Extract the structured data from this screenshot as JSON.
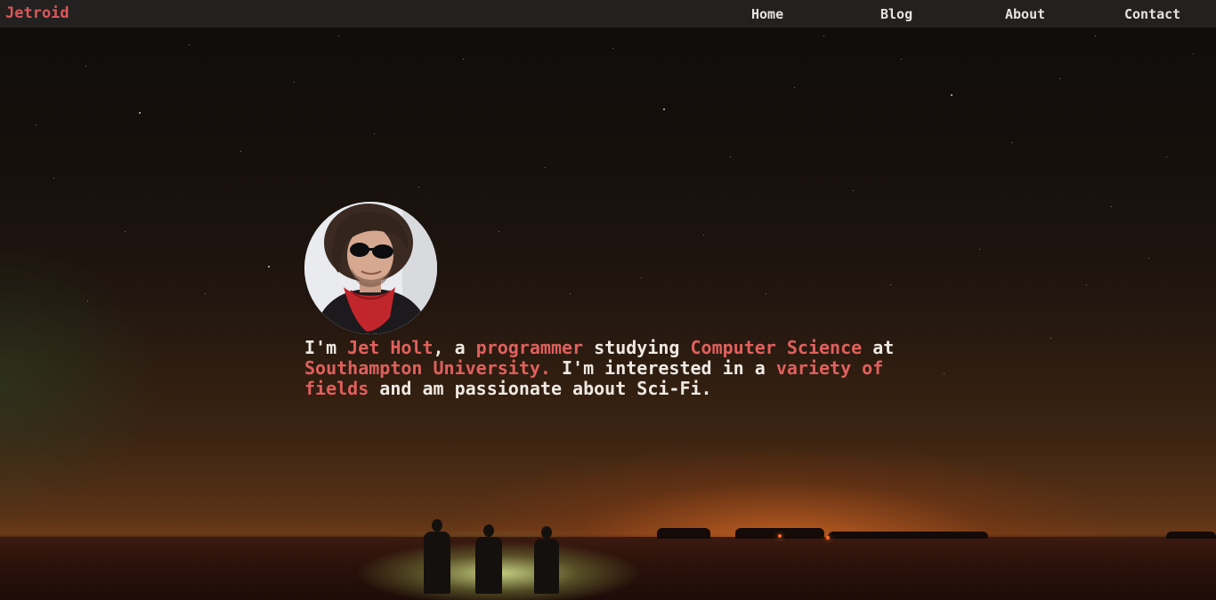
{
  "nav": {
    "brand": "Jetroid",
    "links": [
      "Home",
      "Blog",
      "About",
      "Contact"
    ]
  },
  "profile": {
    "avatar_alt": "Portrait of Jet Holt"
  },
  "bio": {
    "p1": "I'm ",
    "name": "Jet Holt",
    "p2": ", a ",
    "role": "programmer",
    "p3": " studying ",
    "subject": "Computer Science",
    "p4": " at ",
    "university": "Southampton University.",
    "p5": " I'm interested in a ",
    "interests": "variety of fields",
    "p6": " and am passionate about Sci-Fi."
  },
  "colors": {
    "accent": "#e0605d",
    "nav_bg": "#222120",
    "text": "#eee9e2"
  }
}
